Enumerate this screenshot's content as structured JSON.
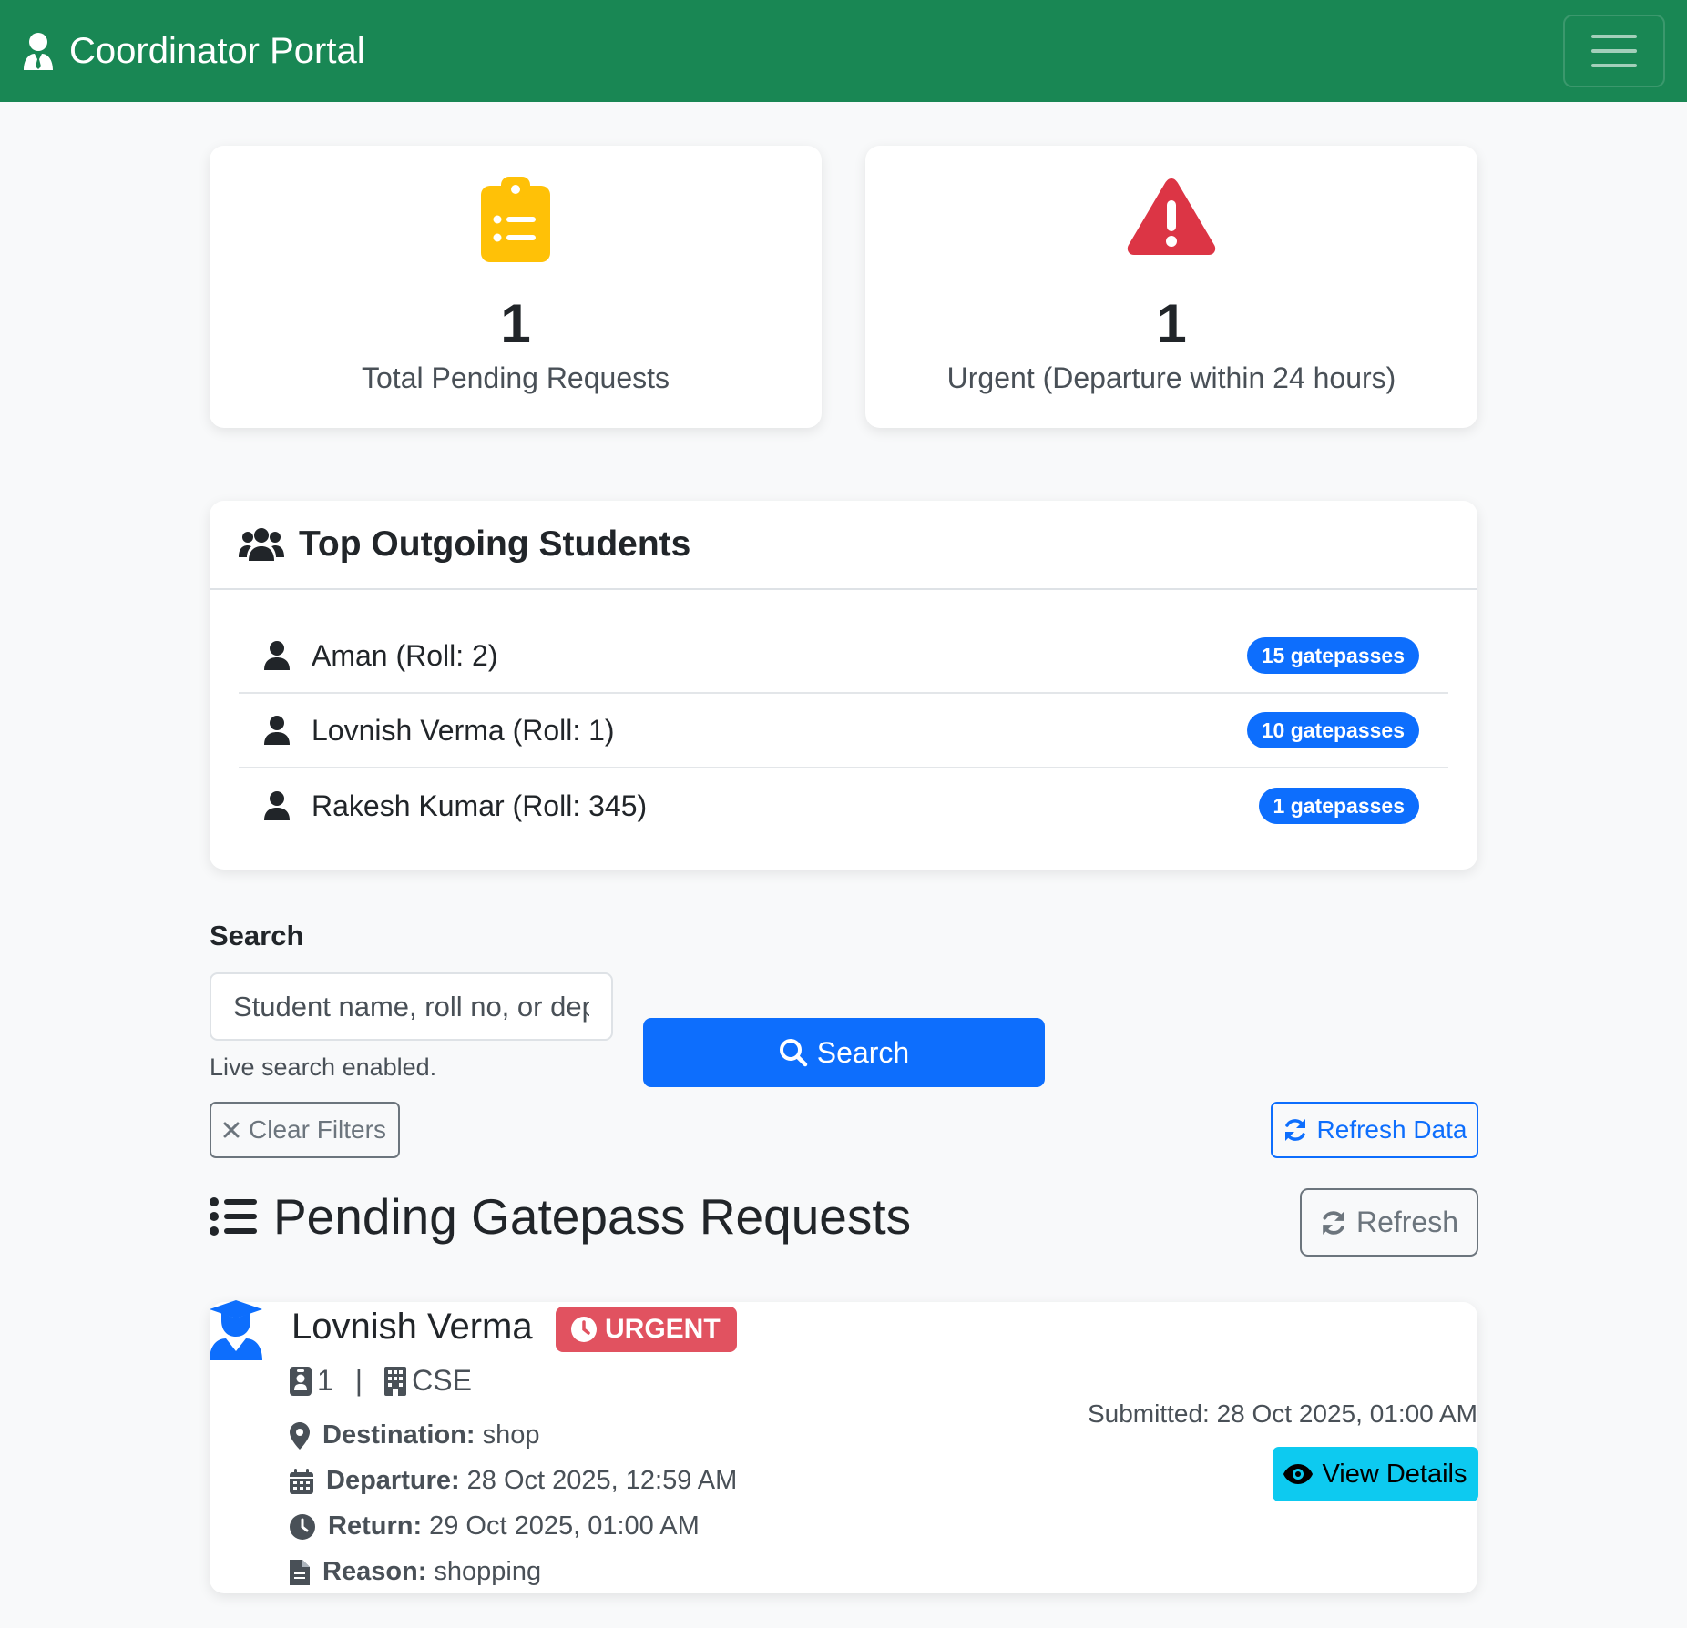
{
  "navbar": {
    "brand": "Coordinator Portal",
    "brand_icon": "user-tie-icon",
    "toggler_icon": "hamburger-icon"
  },
  "stats": {
    "pending": {
      "value": "1",
      "label": "Total Pending Requests",
      "icon": "clipboard-list-icon",
      "color": "#ffc107"
    },
    "urgent": {
      "value": "1",
      "label": "Urgent (Departure within 24 hours)",
      "icon": "warning-triangle-icon",
      "color": "#dc3545"
    }
  },
  "top_students": {
    "title": "Top Outgoing Students",
    "icon": "users-icon",
    "items": [
      {
        "name": "Aman (Roll: 2)",
        "badge": "15 gatepasses"
      },
      {
        "name": "Lovnish Verma (Roll: 1)",
        "badge": "10 gatepasses"
      },
      {
        "name": "Rakesh Kumar (Roll: 345)",
        "badge": "1 gatepasses"
      }
    ]
  },
  "search": {
    "label": "Search",
    "placeholder": "Student name, roll no, or department",
    "hint": "Live search enabled.",
    "button": "Search",
    "clear_filters": "Clear Filters",
    "refresh_data": "Refresh Data"
  },
  "pending": {
    "title": "Pending Gatepass Requests",
    "refresh": "Refresh",
    "requests": [
      {
        "student": "Lovnish Verma",
        "tag": "URGENT",
        "roll": "1",
        "separator": "|",
        "department": "CSE",
        "destination_label": "Destination:",
        "destination": "shop",
        "departure_label": "Departure:",
        "departure": "28 Oct 2025, 12:59 AM",
        "return_label": "Return:",
        "return": "29 Oct 2025, 01:00 AM",
        "reason_label": "Reason:",
        "reason": "shopping",
        "submitted": "Submitted: 28 Oct 2025, 01:00 AM",
        "view_details": "View Details"
      }
    ]
  },
  "colors": {
    "navbar": "#198754",
    "primary": "#0d6efd",
    "info": "#0dcaf0",
    "danger": "#dc3545",
    "warning": "#ffc107"
  }
}
